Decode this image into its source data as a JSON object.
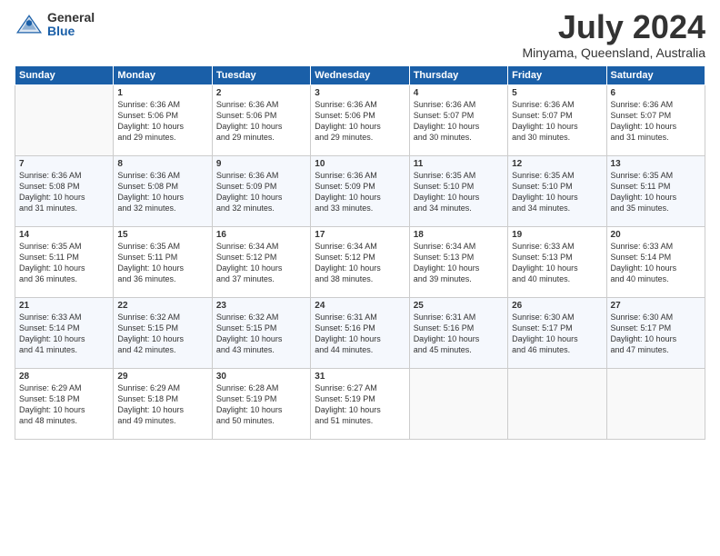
{
  "header": {
    "logo_general": "General",
    "logo_blue": "Blue",
    "month": "July 2024",
    "location": "Minyama, Queensland, Australia"
  },
  "days_of_week": [
    "Sunday",
    "Monday",
    "Tuesday",
    "Wednesday",
    "Thursday",
    "Friday",
    "Saturday"
  ],
  "weeks": [
    [
      {
        "day": "",
        "content": ""
      },
      {
        "day": "1",
        "content": "Sunrise: 6:36 AM\nSunset: 5:06 PM\nDaylight: 10 hours\nand 29 minutes."
      },
      {
        "day": "2",
        "content": "Sunrise: 6:36 AM\nSunset: 5:06 PM\nDaylight: 10 hours\nand 29 minutes."
      },
      {
        "day": "3",
        "content": "Sunrise: 6:36 AM\nSunset: 5:06 PM\nDaylight: 10 hours\nand 29 minutes."
      },
      {
        "day": "4",
        "content": "Sunrise: 6:36 AM\nSunset: 5:07 PM\nDaylight: 10 hours\nand 30 minutes."
      },
      {
        "day": "5",
        "content": "Sunrise: 6:36 AM\nSunset: 5:07 PM\nDaylight: 10 hours\nand 30 minutes."
      },
      {
        "day": "6",
        "content": "Sunrise: 6:36 AM\nSunset: 5:07 PM\nDaylight: 10 hours\nand 31 minutes."
      }
    ],
    [
      {
        "day": "7",
        "content": "Sunrise: 6:36 AM\nSunset: 5:08 PM\nDaylight: 10 hours\nand 31 minutes."
      },
      {
        "day": "8",
        "content": "Sunrise: 6:36 AM\nSunset: 5:08 PM\nDaylight: 10 hours\nand 32 minutes."
      },
      {
        "day": "9",
        "content": "Sunrise: 6:36 AM\nSunset: 5:09 PM\nDaylight: 10 hours\nand 32 minutes."
      },
      {
        "day": "10",
        "content": "Sunrise: 6:36 AM\nSunset: 5:09 PM\nDaylight: 10 hours\nand 33 minutes."
      },
      {
        "day": "11",
        "content": "Sunrise: 6:35 AM\nSunset: 5:10 PM\nDaylight: 10 hours\nand 34 minutes."
      },
      {
        "day": "12",
        "content": "Sunrise: 6:35 AM\nSunset: 5:10 PM\nDaylight: 10 hours\nand 34 minutes."
      },
      {
        "day": "13",
        "content": "Sunrise: 6:35 AM\nSunset: 5:11 PM\nDaylight: 10 hours\nand 35 minutes."
      }
    ],
    [
      {
        "day": "14",
        "content": "Sunrise: 6:35 AM\nSunset: 5:11 PM\nDaylight: 10 hours\nand 36 minutes."
      },
      {
        "day": "15",
        "content": "Sunrise: 6:35 AM\nSunset: 5:11 PM\nDaylight: 10 hours\nand 36 minutes."
      },
      {
        "day": "16",
        "content": "Sunrise: 6:34 AM\nSunset: 5:12 PM\nDaylight: 10 hours\nand 37 minutes."
      },
      {
        "day": "17",
        "content": "Sunrise: 6:34 AM\nSunset: 5:12 PM\nDaylight: 10 hours\nand 38 minutes."
      },
      {
        "day": "18",
        "content": "Sunrise: 6:34 AM\nSunset: 5:13 PM\nDaylight: 10 hours\nand 39 minutes."
      },
      {
        "day": "19",
        "content": "Sunrise: 6:33 AM\nSunset: 5:13 PM\nDaylight: 10 hours\nand 40 minutes."
      },
      {
        "day": "20",
        "content": "Sunrise: 6:33 AM\nSunset: 5:14 PM\nDaylight: 10 hours\nand 40 minutes."
      }
    ],
    [
      {
        "day": "21",
        "content": "Sunrise: 6:33 AM\nSunset: 5:14 PM\nDaylight: 10 hours\nand 41 minutes."
      },
      {
        "day": "22",
        "content": "Sunrise: 6:32 AM\nSunset: 5:15 PM\nDaylight: 10 hours\nand 42 minutes."
      },
      {
        "day": "23",
        "content": "Sunrise: 6:32 AM\nSunset: 5:15 PM\nDaylight: 10 hours\nand 43 minutes."
      },
      {
        "day": "24",
        "content": "Sunrise: 6:31 AM\nSunset: 5:16 PM\nDaylight: 10 hours\nand 44 minutes."
      },
      {
        "day": "25",
        "content": "Sunrise: 6:31 AM\nSunset: 5:16 PM\nDaylight: 10 hours\nand 45 minutes."
      },
      {
        "day": "26",
        "content": "Sunrise: 6:30 AM\nSunset: 5:17 PM\nDaylight: 10 hours\nand 46 minutes."
      },
      {
        "day": "27",
        "content": "Sunrise: 6:30 AM\nSunset: 5:17 PM\nDaylight: 10 hours\nand 47 minutes."
      }
    ],
    [
      {
        "day": "28",
        "content": "Sunrise: 6:29 AM\nSunset: 5:18 PM\nDaylight: 10 hours\nand 48 minutes."
      },
      {
        "day": "29",
        "content": "Sunrise: 6:29 AM\nSunset: 5:18 PM\nDaylight: 10 hours\nand 49 minutes."
      },
      {
        "day": "30",
        "content": "Sunrise: 6:28 AM\nSunset: 5:19 PM\nDaylight: 10 hours\nand 50 minutes."
      },
      {
        "day": "31",
        "content": "Sunrise: 6:27 AM\nSunset: 5:19 PM\nDaylight: 10 hours\nand 51 minutes."
      },
      {
        "day": "",
        "content": ""
      },
      {
        "day": "",
        "content": ""
      },
      {
        "day": "",
        "content": ""
      }
    ]
  ]
}
